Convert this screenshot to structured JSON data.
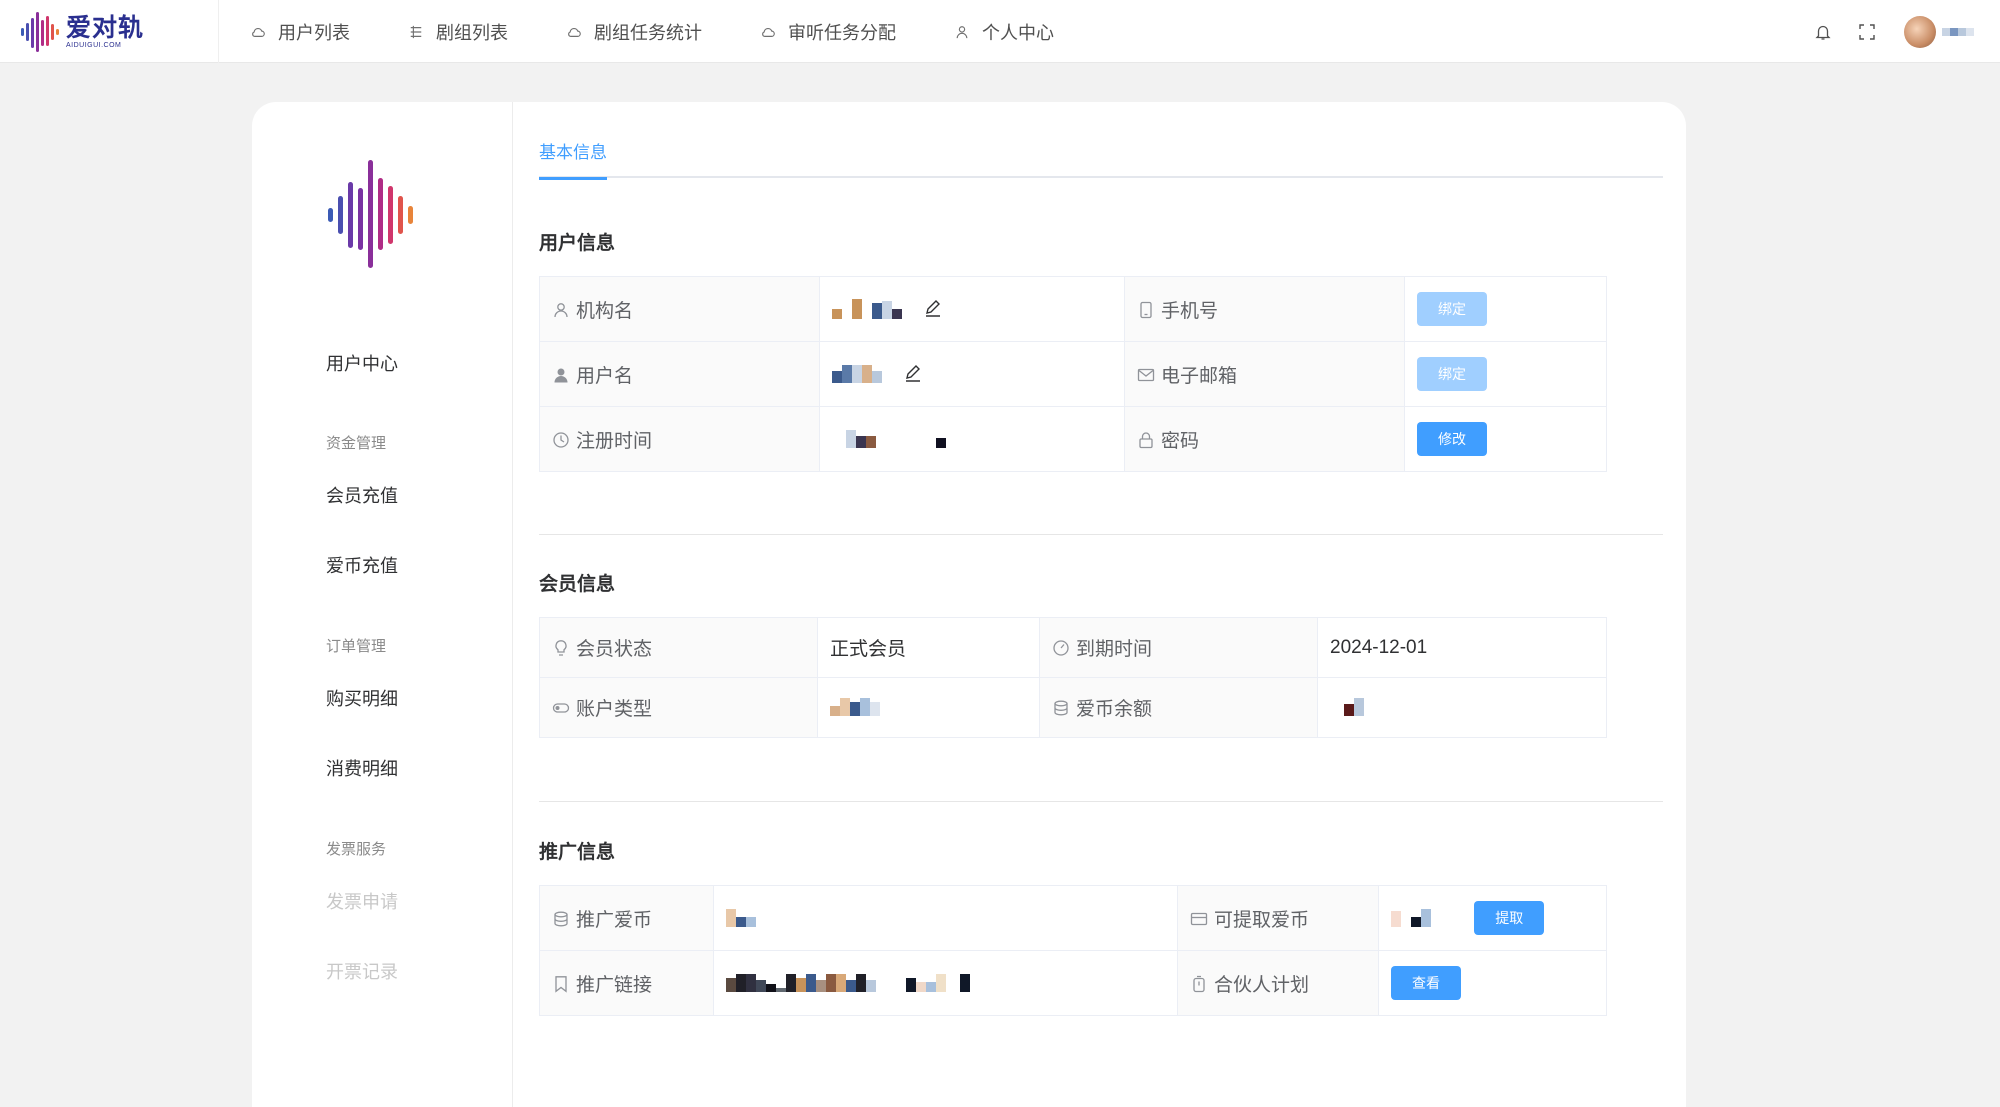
{
  "brand": {
    "name": "爱对轨",
    "sub": "AIDUIGUI.COM"
  },
  "nav": [
    {
      "label": "用户列表",
      "icon": "cloud-icon"
    },
    {
      "label": "剧组列表",
      "icon": "list-icon"
    },
    {
      "label": "剧组任务统计",
      "icon": "cloud-icon"
    },
    {
      "label": "审听任务分配",
      "icon": "cloud-icon"
    },
    {
      "label": "个人中心",
      "icon": "user-icon"
    }
  ],
  "sidebar": {
    "user_center": "用户中心",
    "group_funds": "资金管理",
    "member_recharge": "会员充值",
    "coin_recharge": "爱币充值",
    "group_orders": "订单管理",
    "purchase_detail": "购买明细",
    "consume_detail": "消费明细",
    "group_invoice": "发票服务",
    "invoice_apply": "发票申请",
    "invoice_record": "开票记录"
  },
  "tab": {
    "label": "基本信息"
  },
  "user_info": {
    "title": "用户信息",
    "org_label": "机构名",
    "username_label": "用户名",
    "reg_time_label": "注册时间",
    "phone_label": "手机号",
    "email_label": "电子邮箱",
    "password_label": "密码",
    "bind_phone": "绑定",
    "bind_email": "绑定",
    "change_pwd": "修改"
  },
  "member_info": {
    "title": "会员信息",
    "status_label": "会员状态",
    "status_value": "正式会员",
    "expire_label": "到期时间",
    "expire_value": "2024-12-01",
    "account_type_label": "账户类型",
    "balance_label": "爱币余额"
  },
  "promo_info": {
    "title": "推广信息",
    "coins_label": "推广爱币",
    "withdrawable_label": "可提取爱币",
    "withdraw_btn": "提取",
    "link_label": "推广链接",
    "partner_label": "合伙人计划",
    "view_btn": "查看"
  },
  "colors": {
    "accent": "#409eff",
    "accent_light": "#a0cfff",
    "brand": "#2a2f8f"
  }
}
